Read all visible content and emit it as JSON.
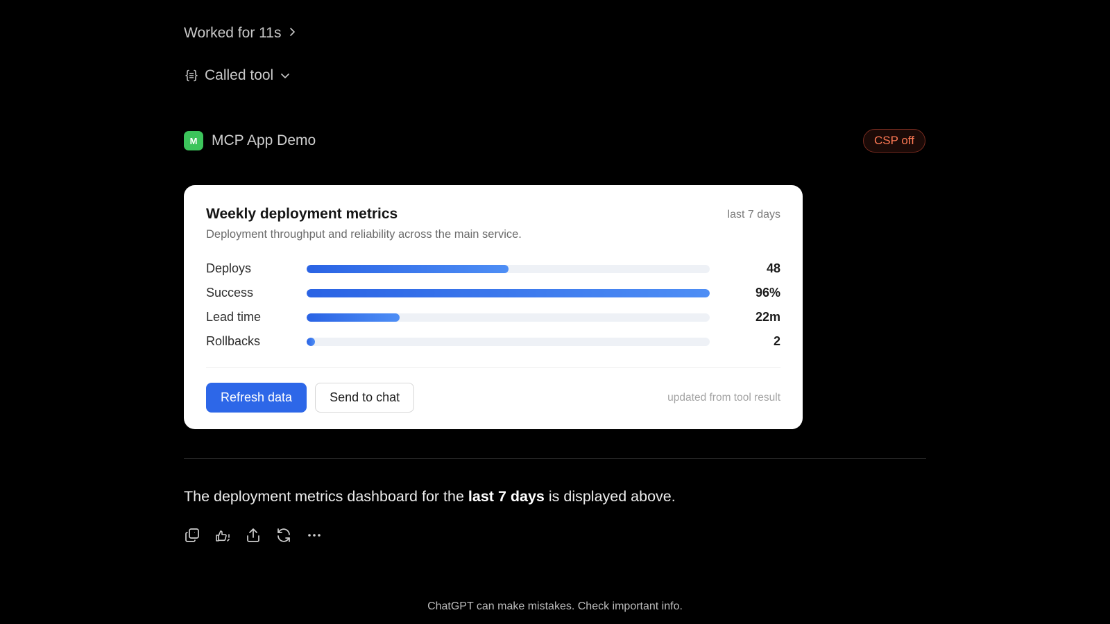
{
  "thread": {
    "worked_label": "Worked for 11s",
    "called_tool_label": "Called tool"
  },
  "app": {
    "badge_letter": "M",
    "badge_color": "#3cc45b",
    "name": "MCP App Demo",
    "csp_label": "CSP off",
    "csp_color": "#ff7a55"
  },
  "card": {
    "title": "Weekly deployment metrics",
    "range": "last 7 days",
    "subtitle": "Deployment throughput and reliability across the main service.",
    "metrics": [
      {
        "label": "Deploys",
        "value": "48",
        "fill_fraction": 0.5
      },
      {
        "label": "Success",
        "value": "96%",
        "fill_fraction": 1.0
      },
      {
        "label": "Lead time",
        "value": "22m",
        "fill_fraction": 0.23
      },
      {
        "label": "Rollbacks",
        "value": "2",
        "fill_fraction": 0.02
      }
    ],
    "refresh_label": "Refresh data",
    "send_label": "Send to chat",
    "footnote": "updated from tool result",
    "accent_color": "#2d67e8"
  },
  "answer": {
    "prefix": "The deployment metrics dashboard for the ",
    "bold": "last 7 days",
    "suffix": " is displayed above."
  },
  "actions": [
    "copy-icon",
    "thumbs-icon",
    "share-icon",
    "regenerate-icon",
    "more-icon"
  ],
  "footer": {
    "disclaimer": "ChatGPT can make mistakes. Check important info."
  }
}
